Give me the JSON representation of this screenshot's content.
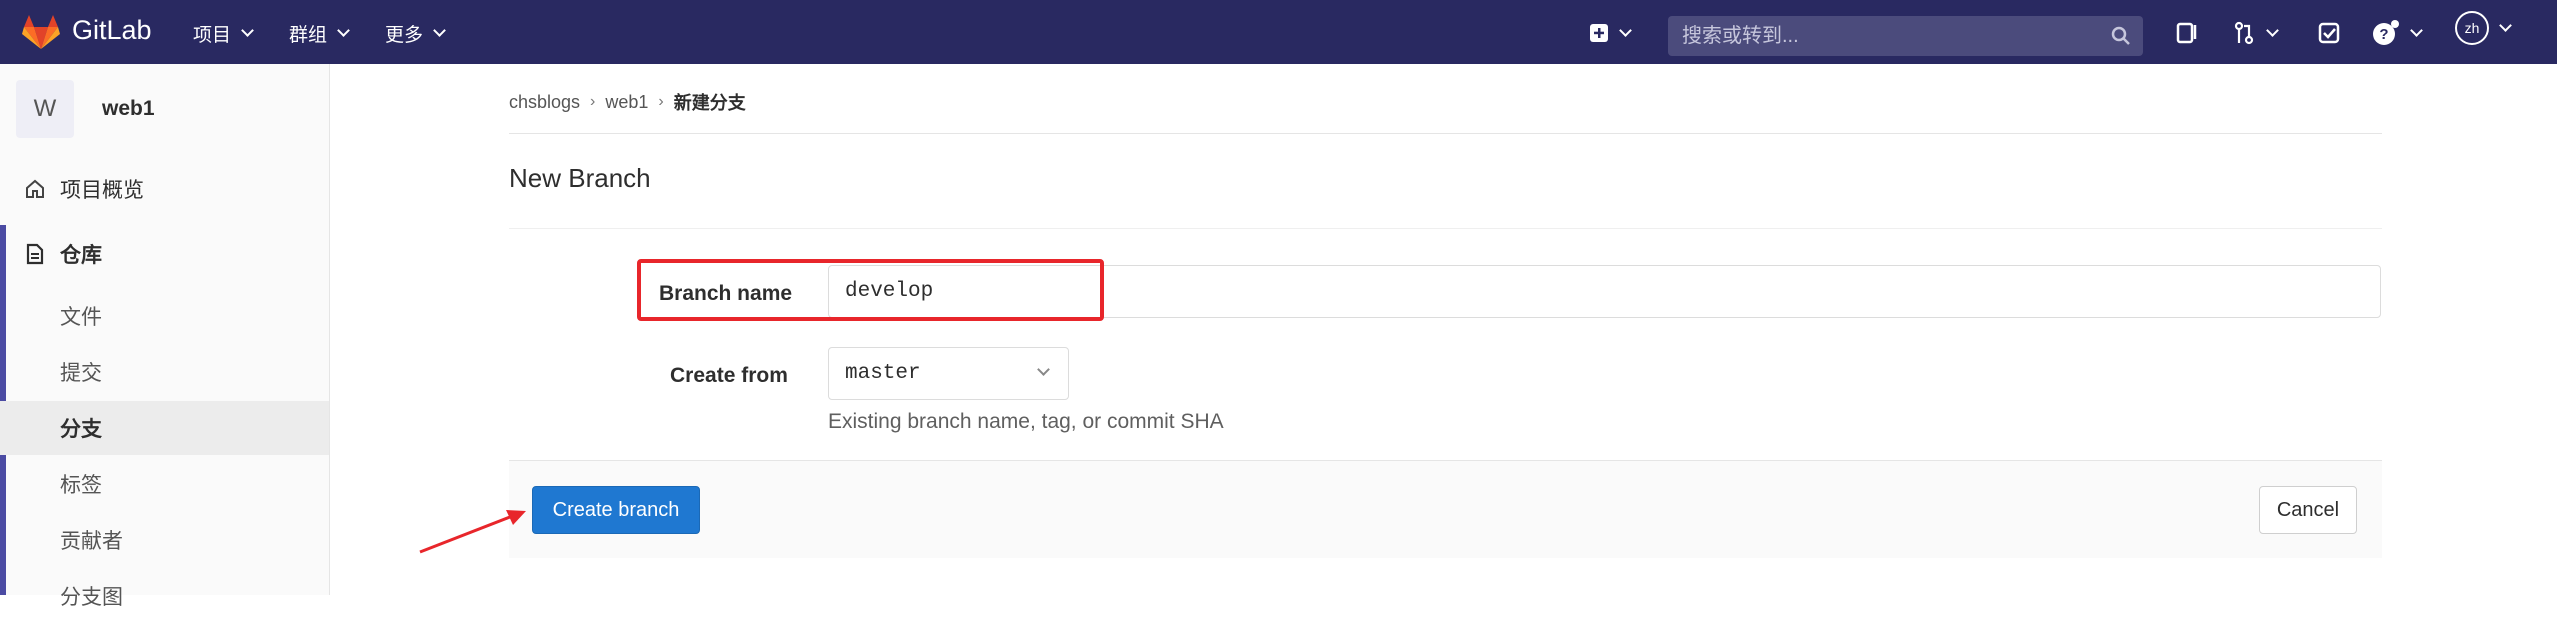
{
  "navbar": {
    "brand": "GitLab",
    "menus": [
      "项目",
      "群组",
      "更多"
    ],
    "search_placeholder": "搜索或转到...",
    "user_initials": "zh"
  },
  "sidebar": {
    "project_initial": "W",
    "project_name": "web1",
    "items": [
      {
        "label": "项目概览",
        "icon": "home-icon"
      },
      {
        "label": "仓库",
        "icon": "document-icon"
      }
    ],
    "sub_items": [
      "文件",
      "提交",
      "分支",
      "标签",
      "贡献者",
      "分支图"
    ],
    "active_sub_index": 2
  },
  "breadcrumb": {
    "items": [
      "chsblogs",
      "web1"
    ],
    "current": "新建分支"
  },
  "page": {
    "title": "New Branch",
    "branch_name_label": "Branch name",
    "branch_name_value": "develop",
    "create_from_label": "Create from",
    "create_from_value": "master",
    "help_text": "Existing branch name, tag, or commit SHA",
    "create_button": "Create branch",
    "cancel_button": "Cancel"
  },
  "colors": {
    "navbar": "#292961",
    "primary": "#1f78d1",
    "highlight": "#e8262b",
    "sidebar_active_bar": "#4b4ba3"
  }
}
